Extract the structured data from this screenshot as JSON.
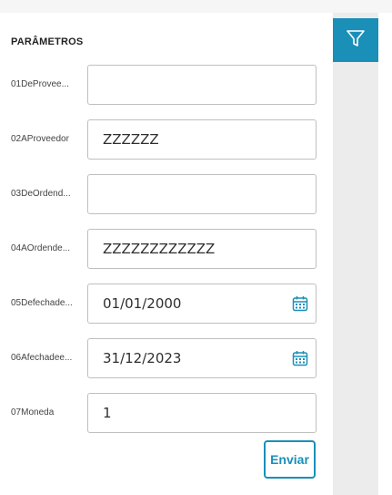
{
  "section_title": "PARÂMETROS",
  "params": [
    {
      "label": "01DeProvee...",
      "value": "",
      "type": "text"
    },
    {
      "label": "02AProveedor",
      "value": "ZZZZZZ",
      "type": "text"
    },
    {
      "label": "03DeOrdend...",
      "value": "",
      "type": "text"
    },
    {
      "label": "04AOrdende...",
      "value": "ZZZZZZZZZZZZ",
      "type": "text"
    },
    {
      "label": "05Defechade...",
      "value": "01/01/2000",
      "type": "date"
    },
    {
      "label": "06Afechadee...",
      "value": "31/12/2023",
      "type": "date"
    },
    {
      "label": "07Moneda",
      "value": "1",
      "type": "text"
    }
  ],
  "submit_label": "Enviar",
  "colors": {
    "accent": "#1a8fb8",
    "sidebar": "#ececec"
  },
  "icons": {
    "filter": "filter-icon",
    "calendar": "calendar-icon"
  }
}
